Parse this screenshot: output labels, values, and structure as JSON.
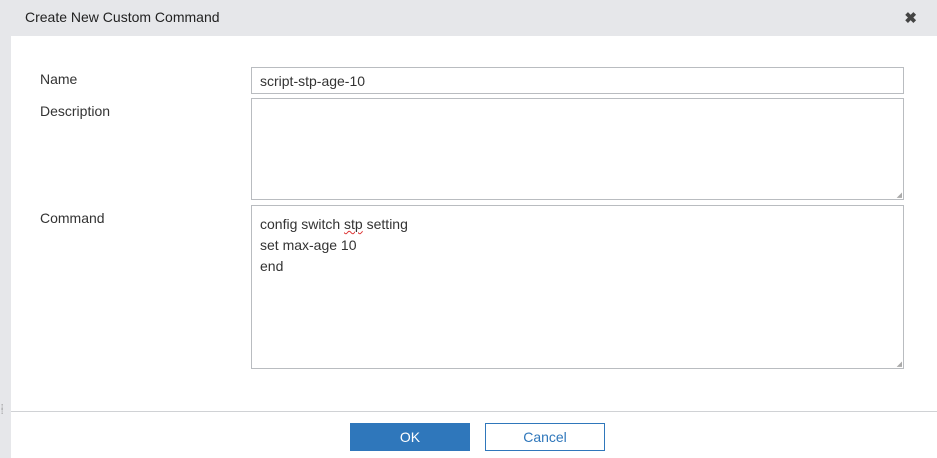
{
  "dialog": {
    "title": "Create New Custom Command",
    "close_icon": "close-icon"
  },
  "form": {
    "name_label": "Name",
    "name_value": "script-stp-age-10",
    "description_label": "Description",
    "description_value": "",
    "command_label": "Command",
    "command_lines": {
      "line1_a": "config switch ",
      "line1_b": "stp",
      "line1_c": " setting",
      "line2": "set max-age 10",
      "line3": "end"
    }
  },
  "footer": {
    "ok_label": "OK",
    "cancel_label": "Cancel"
  },
  "colors": {
    "accent": "#2f77bb",
    "header_bg": "#e6e7ea"
  }
}
